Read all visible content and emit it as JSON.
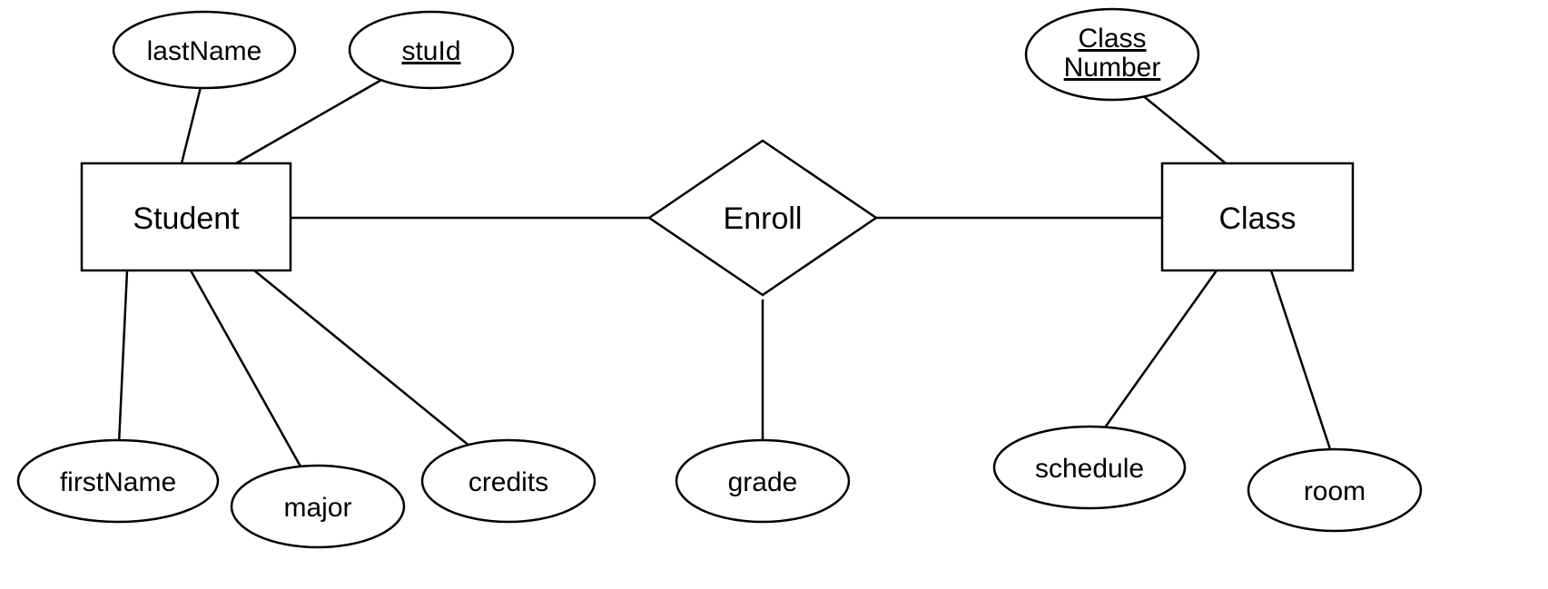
{
  "entities": {
    "student": {
      "label": "Student"
    },
    "class": {
      "label": "Class"
    }
  },
  "relationship": {
    "enroll": {
      "label": "Enroll"
    }
  },
  "attributes": {
    "lastName": {
      "label": "lastName",
      "key": false
    },
    "stuId": {
      "label": "stuId",
      "key": true
    },
    "firstName": {
      "label": "firstName",
      "key": false
    },
    "major": {
      "label": "major",
      "key": false
    },
    "credits": {
      "label": "credits",
      "key": false
    },
    "grade": {
      "label": "grade",
      "key": false
    },
    "classNumber": {
      "line1": "Class",
      "line2": "Number",
      "key": true
    },
    "schedule": {
      "label": "schedule",
      "key": false
    },
    "room": {
      "label": "room",
      "key": false
    }
  }
}
